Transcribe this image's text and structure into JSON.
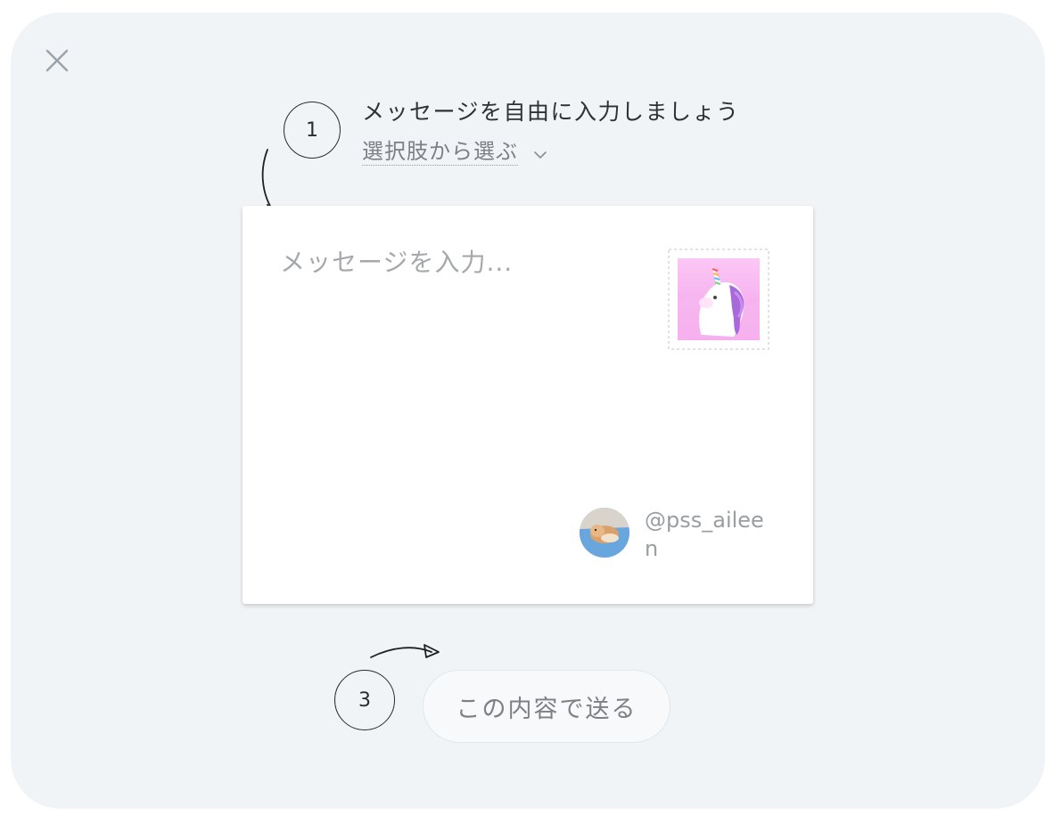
{
  "dialog": {
    "close_icon": "close-icon"
  },
  "steps": {
    "step1": "1",
    "step3": "3"
  },
  "instruction": "メッセージを自由に入力しましょう",
  "choice": {
    "label": "選択肢から選ぶ",
    "icon": "chevron-down-icon"
  },
  "card": {
    "message_placeholder": "メッセージを入力...",
    "message_value": "",
    "stamp_icon": "unicorn-stamp-icon",
    "sender_handle": "@pss_aileen"
  },
  "send": {
    "label": "この内容で送る"
  },
  "colors": {
    "background": "#f0f4f7",
    "card": "#ffffff",
    "stamp_pink": "#f4b3ec"
  }
}
